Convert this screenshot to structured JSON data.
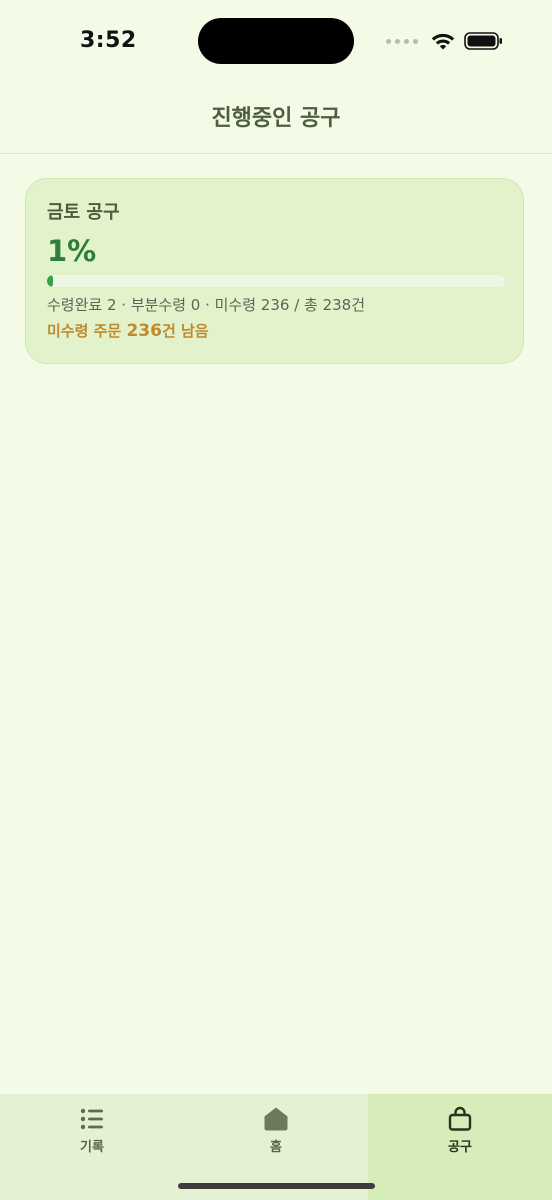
{
  "status_bar": {
    "time": "3:52"
  },
  "header": {
    "title": "진행중인 공구"
  },
  "card": {
    "title": "금토 공구",
    "percent_label": "1%",
    "progress_fraction": 0.0084,
    "stats": "수령완료 2 · 부분수령 0 · 미수령 236 / 총 238건",
    "remaining_prefix": "미수령 주문 ",
    "remaining_count": "236",
    "remaining_suffix": "건 남음"
  },
  "tabs": [
    {
      "label": "기록",
      "icon": "list-icon",
      "active": false
    },
    {
      "label": "홈",
      "icon": "home-icon",
      "active": false
    },
    {
      "label": "공구",
      "icon": "bag-icon",
      "active": true
    }
  ],
  "colors": {
    "background": "#f3fbe6",
    "card_background": "#e2f3cb",
    "accent_green": "#2e7d3a",
    "progress_green": "#3aa14b",
    "warning_orange": "#c0892d",
    "tab_active_bg": "#d6ecb9"
  }
}
